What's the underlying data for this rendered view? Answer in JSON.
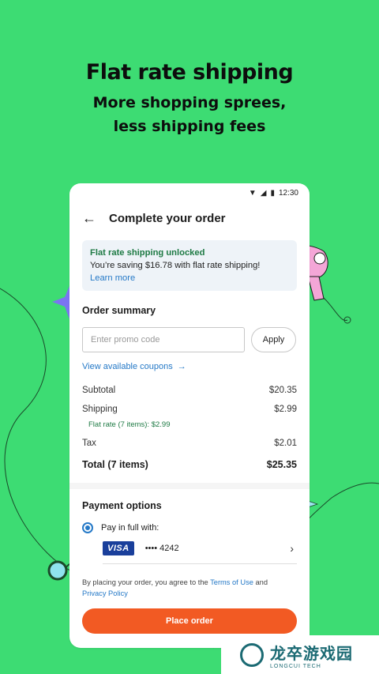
{
  "hero": {
    "title": "Flat rate shipping",
    "subtitle_line1": "More shopping sprees,",
    "subtitle_line2": "less shipping fees"
  },
  "status_bar": {
    "time": "12:30"
  },
  "header": {
    "title": "Complete your order",
    "back_icon": "arrow-left"
  },
  "banner": {
    "headline": "Flat rate shipping unlocked",
    "message": "You’re saving $16.78 with flat rate shipping!",
    "link": "Learn more"
  },
  "order_summary": {
    "title": "Order summary",
    "promo_placeholder": "Enter promo code",
    "apply_label": "Apply",
    "coupons_link": "View available coupons",
    "subtotal_label": "Subtotal",
    "subtotal_value": "$20.35",
    "shipping_label": "Shipping",
    "shipping_value": "$2.99",
    "flat_rate_note": "Flat rate (7 items): $2.99",
    "tax_label": "Tax",
    "tax_value": "$2.01",
    "total_label": "Total (7 items)",
    "total_value": "$25.35"
  },
  "payment": {
    "title": "Payment options",
    "option_label": "Pay in full with:",
    "card_brand": "VISA",
    "card_number": "•••• 4242"
  },
  "legal": {
    "prefix": "By placing your order, you agree to the ",
    "terms_link": "Terms of Use",
    "and": " and",
    "privacy_link": "Privacy Policy"
  },
  "place_order_label": "Place order",
  "watermark": {
    "name": "龙卒游戏园",
    "sub": "LONGCUI TECH"
  },
  "colors": {
    "background": "#3ddc73",
    "accent": "#f25a23",
    "link": "#2579c7",
    "success": "#1e7a44"
  }
}
